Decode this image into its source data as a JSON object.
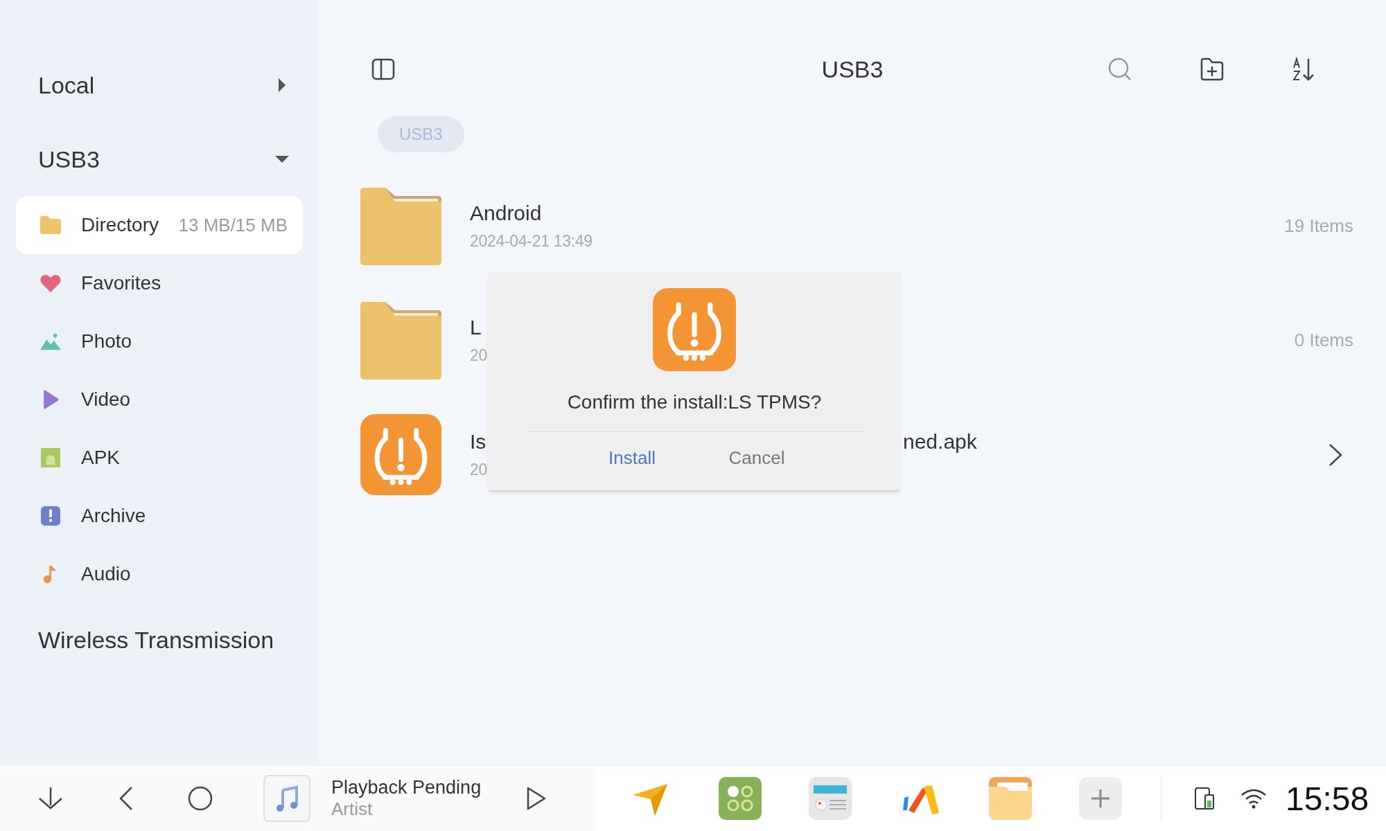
{
  "sidebar": {
    "sections": [
      {
        "label": "Local",
        "expanded": false
      },
      {
        "label": "USB3",
        "expanded": true
      }
    ],
    "items": [
      {
        "label": "Directory",
        "kind": "folder",
        "selected": true,
        "detail": "13 MB/15 MB"
      },
      {
        "label": "Favorites",
        "kind": "heart",
        "selected": false
      },
      {
        "label": "Photo",
        "kind": "photo",
        "selected": false
      },
      {
        "label": "Video",
        "kind": "video",
        "selected": false
      },
      {
        "label": "APK",
        "kind": "apk",
        "selected": false
      },
      {
        "label": "Archive",
        "kind": "archive",
        "selected": false
      },
      {
        "label": "Audio",
        "kind": "audio",
        "selected": false
      }
    ],
    "footer": "Wireless Transmission"
  },
  "header": {
    "title": "USB3",
    "breadcrumb": [
      "USB3"
    ]
  },
  "files": [
    {
      "kind": "folder",
      "name": "Android",
      "date": "2024-04-21 13:49",
      "count": "19 Items"
    },
    {
      "kind": "folder",
      "name": "L",
      "date": "20",
      "count": "0 Items"
    },
    {
      "kind": "apk",
      "name": "Is",
      "name_tail": "ned.apk",
      "date": "20"
    }
  ],
  "dialog": {
    "message": "Confirm the install:LS TPMS?",
    "buttons": [
      {
        "label": "Install",
        "kind": "primary"
      },
      {
        "label": "Cancel",
        "kind": "secondary"
      }
    ]
  },
  "taskbar": {
    "track_title": "Playback Pending",
    "artist": "Artist",
    "time": "15:58"
  }
}
